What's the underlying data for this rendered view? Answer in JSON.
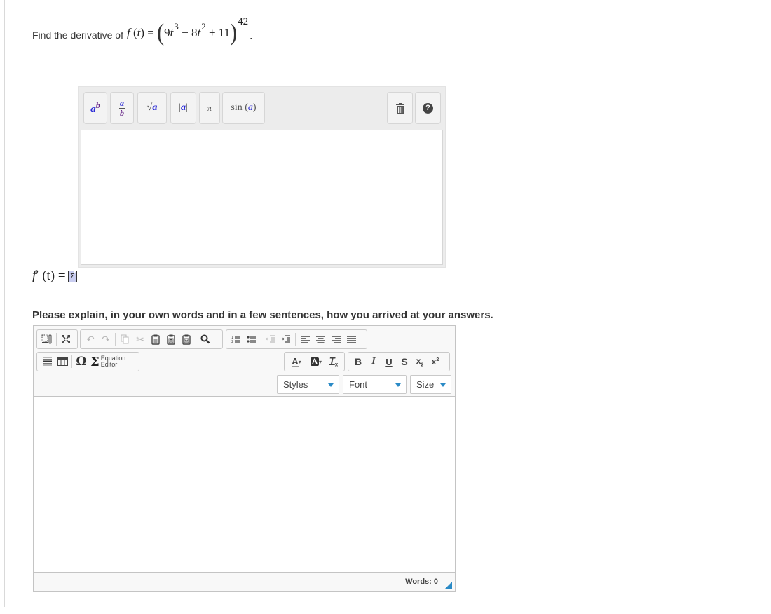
{
  "question": {
    "prefix": "Find the derivative of",
    "function_name": "f",
    "variable": "t",
    "equals": "=",
    "terms": {
      "coef1": "9",
      "exp1": "3",
      "op1": "−",
      "coef2": "8",
      "exp2": "2",
      "op2": "+",
      "const": "11"
    },
    "outer_exponent": "42",
    "suffix": "."
  },
  "math_editor": {
    "buttons": [
      {
        "name": "exponent",
        "label": "a^b"
      },
      {
        "name": "fraction",
        "label": "a/b"
      },
      {
        "name": "square-root",
        "label": "√a"
      },
      {
        "name": "absolute-value",
        "label": "|a|"
      },
      {
        "name": "pi",
        "label": "π"
      },
      {
        "name": "sin",
        "label": "sin (a)"
      }
    ],
    "trash_label": "trash",
    "help_label": "?",
    "value": ""
  },
  "answer": {
    "label_fn": "f",
    "prime": "′",
    "var": "(t)",
    "equals": "=",
    "eq_icon": "Σ"
  },
  "explain": {
    "prompt": "Please explain, in your own words and in a few sentences, how you arrived at your answers."
  },
  "rich_editor": {
    "equation_editor_line1": "Equation",
    "equation_editor_line2": "Editor",
    "omega": "Ω",
    "sigma": "Σ",
    "bold": "B",
    "italic": "I",
    "underline": "U",
    "strike": "S",
    "subscript": "x₂",
    "superscript": "x²",
    "text_color": "A",
    "bg_color": "A",
    "remove_format": "Tx",
    "styles_label": "Styles",
    "font_label": "Font",
    "size_label": "Size",
    "content": "",
    "words_label": "Words: 0"
  }
}
